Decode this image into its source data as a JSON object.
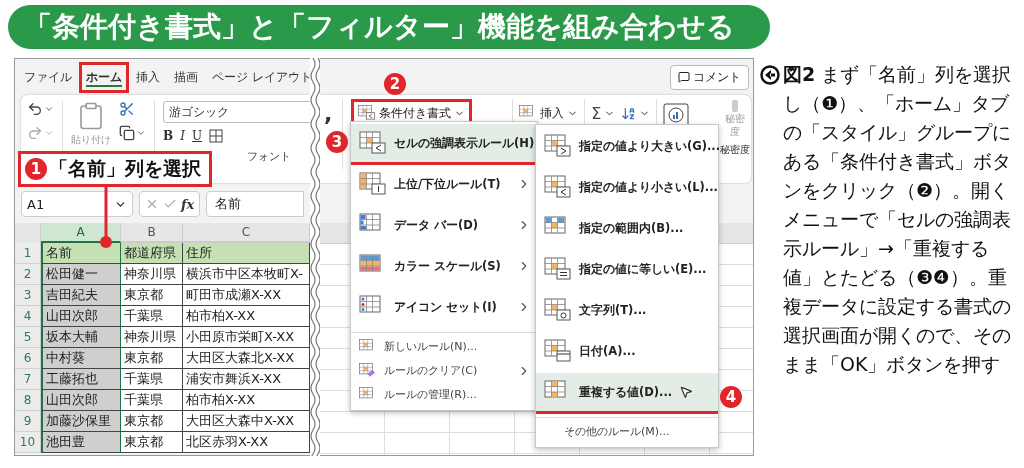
{
  "banner": {
    "title": "「条件付き書式」と「フィルター」機能を組み合わせる"
  },
  "excel_left": {
    "tabs": [
      {
        "label": "ファイル",
        "selected": false
      },
      {
        "label": "ホーム",
        "selected": true
      },
      {
        "label": "挿入",
        "selected": false
      },
      {
        "label": "描画",
        "selected": false
      },
      {
        "label": "ページ レイアウト",
        "selected": false
      }
    ],
    "paste_button": {
      "label": "貼り付け",
      "disabled": true
    },
    "font_field": "游ゴシック",
    "format_buttons": [
      "B",
      "I",
      "U"
    ],
    "font_group_label": "フォント",
    "callout": {
      "number": "1",
      "text": "「名前」列を選択"
    },
    "name_box": "A1",
    "fx_label": "fx",
    "formula_value": "名前",
    "columns": [
      {
        "label": "A",
        "selected": true
      },
      {
        "label": "B",
        "selected": false
      },
      {
        "label": "C",
        "selected": false
      }
    ],
    "rows": [
      {
        "number": "1",
        "kind": "header",
        "cells": [
          "名前",
          "都道府県",
          "住所"
        ]
      },
      {
        "number": "2",
        "kind": "data",
        "cells": [
          "松田健一",
          "神奈川県",
          "横浜市中区本牧町X-"
        ]
      },
      {
        "number": "3",
        "kind": "data",
        "cells": [
          "吉田紀夫",
          "東京都",
          "町田市成瀬X-XX"
        ]
      },
      {
        "number": "4",
        "kind": "data",
        "cells": [
          "山田次郎",
          "千葉県",
          "柏市柏X-XX"
        ]
      },
      {
        "number": "5",
        "kind": "data",
        "cells": [
          "坂本大輔",
          "神奈川県",
          "小田原市栄町X-XX"
        ]
      },
      {
        "number": "6",
        "kind": "data",
        "cells": [
          "中村葵",
          "東京都",
          "大田区大森北X-XX"
        ]
      },
      {
        "number": "7",
        "kind": "data",
        "cells": [
          "工藤拓也",
          "千葉県",
          "浦安市舞浜X-XX"
        ]
      },
      {
        "number": "8",
        "kind": "data",
        "cells": [
          "山田次郎",
          "千葉県",
          "柏市柏X-XX"
        ]
      },
      {
        "number": "9",
        "kind": "data",
        "cells": [
          "加藤沙保里",
          "東京都",
          "大田区大森中X-XX"
        ]
      },
      {
        "number": "10",
        "kind": "data",
        "cells": [
          "池田豊",
          "東京都",
          "北区赤羽X-XX"
        ]
      }
    ]
  },
  "excel_right": {
    "comment_button": "コメント",
    "comma_button": ",",
    "conditional_format_button": "条件付き書式",
    "insert_button": "挿入",
    "autosum_symbol": "Σ",
    "sensitivity_button": {
      "label": "秘密度",
      "disabled": true
    },
    "group_label": "秘密度",
    "markers": {
      "ribbon": "2",
      "menu": "3",
      "submenu": "4"
    },
    "menu": {
      "items": [
        {
          "label": "セルの強調表示ルール(H)",
          "kind": "large",
          "selected": true,
          "has_submenu": true
        },
        {
          "label": "上位/下位ルール(T)",
          "kind": "large",
          "selected": false,
          "has_submenu": true
        },
        {
          "label": "データ バー(D)",
          "kind": "large",
          "selected": false,
          "has_submenu": true
        },
        {
          "label": "カラー スケール(S)",
          "kind": "large",
          "selected": false,
          "has_submenu": true
        },
        {
          "label": "アイコン セット(I)",
          "kind": "large",
          "selected": false,
          "has_submenu": true
        },
        {
          "label": "新しいルール(N)...",
          "kind": "small",
          "selected": false,
          "has_submenu": false
        },
        {
          "label": "ルールのクリア(C)",
          "kind": "small",
          "selected": false,
          "has_submenu": true
        },
        {
          "label": "ルールの管理(R)...",
          "kind": "small",
          "selected": false,
          "has_submenu": false
        }
      ]
    },
    "submenu": {
      "items": [
        {
          "label": "指定の値より大きい(G)...",
          "kind": "large",
          "selected": false
        },
        {
          "label": "指定の値より小さい(L)...",
          "kind": "large",
          "selected": false
        },
        {
          "label": "指定の範囲内(B)...",
          "kind": "large",
          "selected": false
        },
        {
          "label": "指定の値に等しい(E)...",
          "kind": "large",
          "selected": false
        },
        {
          "label": "文字列(T)...",
          "kind": "large",
          "selected": false
        },
        {
          "label": "日付(A)...",
          "kind": "large",
          "selected": false
        },
        {
          "label": "重複する値(D)...",
          "kind": "large",
          "selected": true
        },
        {
          "label": "その他のルール(M)...",
          "kind": "small",
          "selected": false
        }
      ]
    }
  },
  "caption": {
    "text": "**図2** まず「名前」列を選択し（*❶*）、「ホーム」タブの「スタイル」グループにある「条件付き書式」ボタンをクリック（*❷*）。開くメニューで「セルの強調表示ルール」→「重複する値」とたどる（*❸❹*）。重複データに設定する書式の選択画面が開くので、そのまま「OK」ボタンを押す"
  }
}
